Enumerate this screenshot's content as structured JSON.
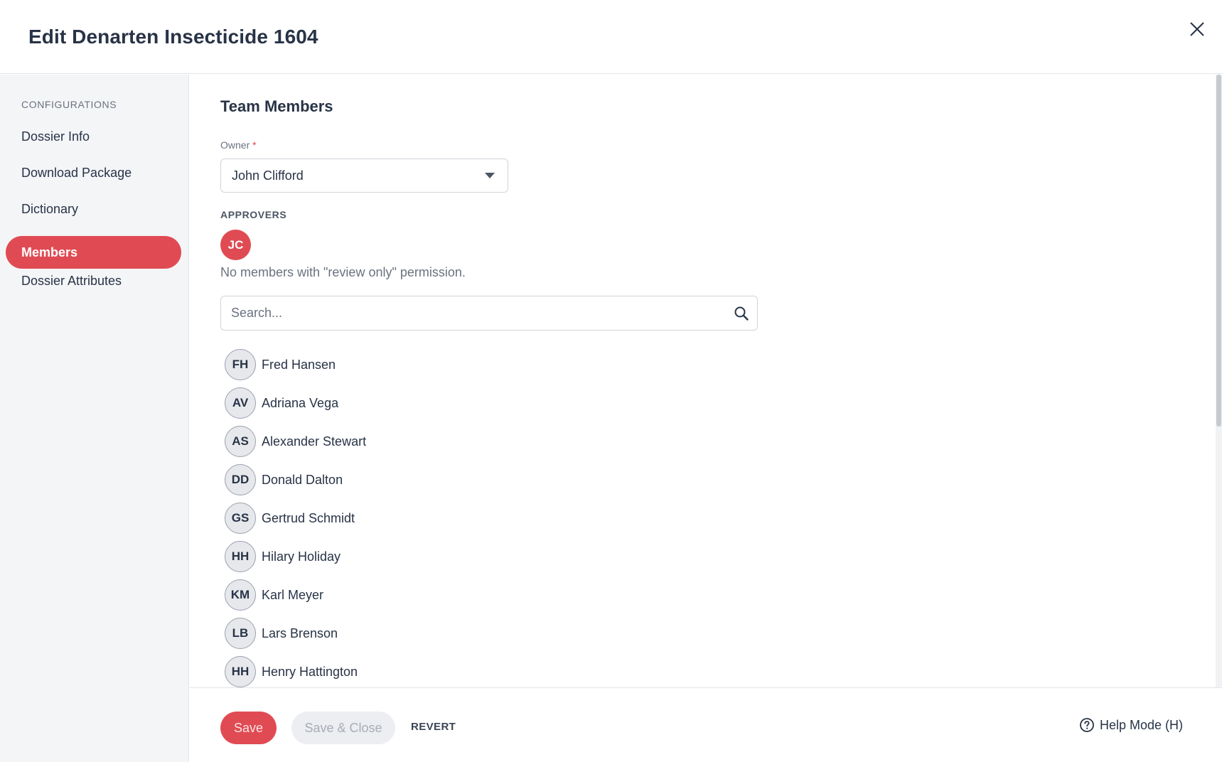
{
  "header": {
    "title": "Edit Denarten Insecticide 1604",
    "close_icon": "close-icon"
  },
  "sidebar": {
    "section_label": "CONFIGURATIONS",
    "items": [
      {
        "label": "Dossier Info",
        "active": false
      },
      {
        "label": "Download Package",
        "active": false
      },
      {
        "label": "Dictionary",
        "active": false
      },
      {
        "label": "Members",
        "active": true
      },
      {
        "label": "Dossier Attributes",
        "active": false
      }
    ]
  },
  "main": {
    "section_title": "Team Members",
    "owner": {
      "label": "Owner",
      "required_mark": "*",
      "value": "John Clifford"
    },
    "approvers": {
      "label": "APPROVERS",
      "avatar_initials": "JC",
      "empty_message": "No members with \"review only\" permission."
    },
    "search": {
      "placeholder": "Search...",
      "value": ""
    },
    "members": [
      {
        "initials": "FH",
        "name": "Fred Hansen"
      },
      {
        "initials": "AV",
        "name": "Adriana Vega"
      },
      {
        "initials": "AS",
        "name": "Alexander Stewart"
      },
      {
        "initials": "DD",
        "name": "Donald Dalton"
      },
      {
        "initials": "GS",
        "name": "Gertrud Schmidt"
      },
      {
        "initials": "HH",
        "name": "Hilary Holiday"
      },
      {
        "initials": "KM",
        "name": "Karl Meyer"
      },
      {
        "initials": "LB",
        "name": "Lars Brenson"
      },
      {
        "initials": "HH",
        "name": "Henry Hattington"
      }
    ]
  },
  "footer": {
    "save_label": "Save",
    "save_close_label": "Save & Close",
    "revert_label": "REVERT",
    "help_label": "Help Mode (H)"
  },
  "colors": {
    "accent": "#e04b53",
    "text": "#283346",
    "muted": "#6b7280",
    "sidebar_bg": "#f4f5f7"
  }
}
